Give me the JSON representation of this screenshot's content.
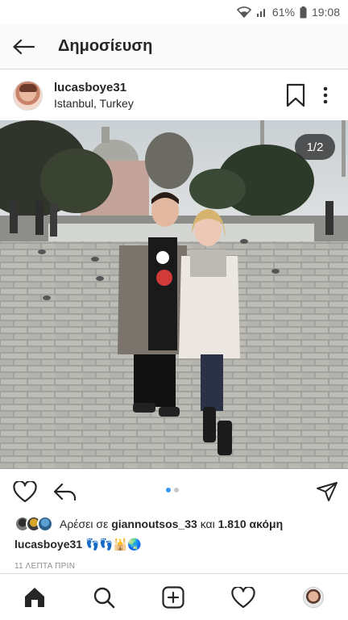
{
  "status_bar": {
    "battery": "61%",
    "time": "19:08"
  },
  "topbar": {
    "title": "Δημοσίευση"
  },
  "post": {
    "username": "lucasboye31",
    "location": "Istanbul, Turkey",
    "counter": "1/2",
    "carousel": {
      "current": 1,
      "total": 2
    }
  },
  "likes": {
    "prefix": "Αρέσει σε",
    "user": "giannoutsos_33",
    "conj": "και",
    "count": "1.810 ακόμη"
  },
  "caption": {
    "username": "lucasboye31",
    "text": "👣👣🕌🌏"
  },
  "timestamp": "11 ΛΕΠΤΑ ΠΡΙΝ",
  "icons": {
    "status": [
      "wifi-icon",
      "signal-icon",
      "battery-icon"
    ],
    "header": [
      "back-arrow-icon",
      "bookmark-icon",
      "more-vertical-icon"
    ],
    "actions": [
      "heart-icon",
      "share-icon",
      "send-icon"
    ],
    "nav": [
      "home-icon",
      "search-icon",
      "add-post-icon",
      "activity-heart-icon",
      "profile-avatar"
    ]
  },
  "colors": {
    "accent": "#3897f0",
    "text": "#262626",
    "muted": "#8e8e8e",
    "border": "#dbdbdb"
  }
}
